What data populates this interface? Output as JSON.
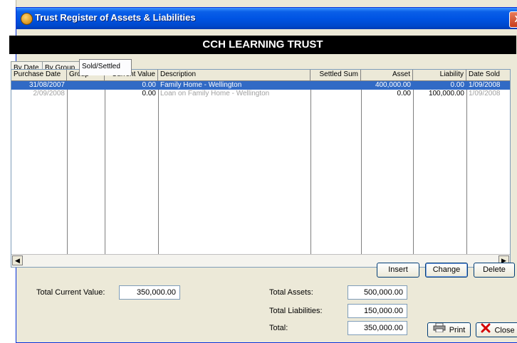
{
  "window": {
    "title": "Trust Register of Assets & Liabilities",
    "close_glyph": "X"
  },
  "banner": {
    "text": "CCH LEARNING TRUST"
  },
  "tabs": [
    {
      "label": "By Date",
      "active": false
    },
    {
      "label": "By Group",
      "active": false
    },
    {
      "label": "Sold/Settled",
      "active": true
    }
  ],
  "grid": {
    "columns": [
      "Purchase Date",
      "Group",
      "Current Value",
      "Description",
      "Settled Sum",
      "Asset",
      "Liability",
      "Date Sold"
    ],
    "rows": [
      {
        "purchase_date": "31/08/2007",
        "group": "",
        "current_value": "0.00",
        "description": "Family Home - Wellington",
        "settled_sum": "",
        "asset": "400,000.00",
        "liability": "0.00",
        "date_sold": "1/09/2008",
        "selected": true
      },
      {
        "purchase_date": "2/09/2008",
        "group": "",
        "current_value": "0.00",
        "description": "Loan on Family Home - Wellington",
        "settled_sum": "",
        "asset": "0.00",
        "liability": "100,000.00",
        "date_sold": "1/09/2008",
        "selected": false
      }
    ]
  },
  "actions": {
    "insert": "Insert",
    "change": "Change",
    "delete": "Delete",
    "print": "Print",
    "close": "Close"
  },
  "totals": {
    "current_value_label": "Total Current Value:",
    "current_value": "350,000.00",
    "assets_label": "Total Assets:",
    "assets": "500,000.00",
    "liabilities_label": "Total Liabilities:",
    "liabilities": "150,000.00",
    "total_label": "Total:",
    "total": "350,000.00"
  }
}
